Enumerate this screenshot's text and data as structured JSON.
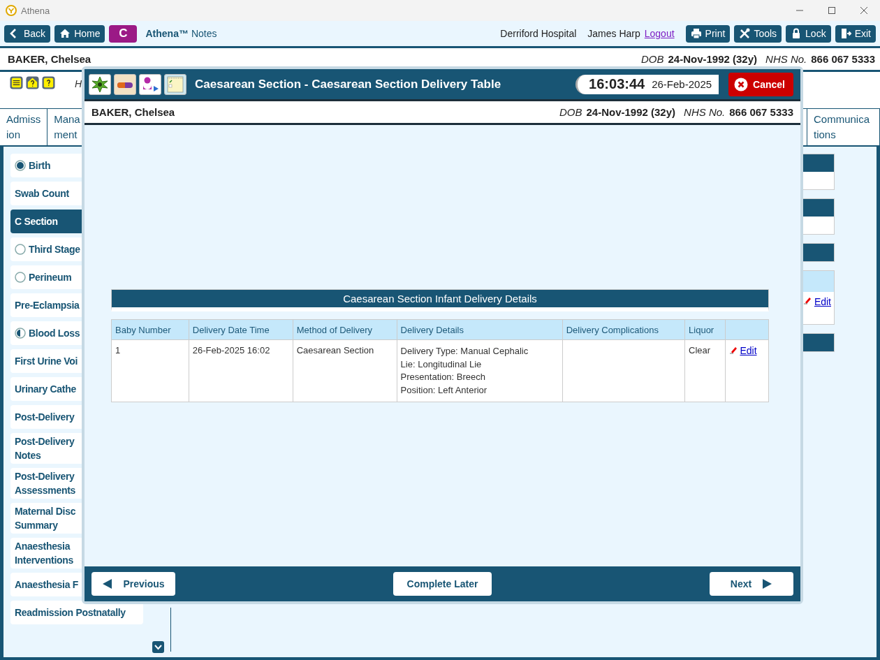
{
  "window": {
    "title": "Athena"
  },
  "toolbar": {
    "nav_buttons": [
      {
        "label": "Back"
      },
      {
        "label": "Home"
      }
    ],
    "app_badge": "C",
    "app_name": "Athena™",
    "app_suffix": "Notes",
    "hospital": "Derriford Hospital",
    "user": "James Harp",
    "logout": "Logout",
    "actions": [
      {
        "label": "Print"
      },
      {
        "label": "Tools"
      },
      {
        "label": "Lock"
      },
      {
        "label": "Exit"
      }
    ]
  },
  "patient": {
    "name": "BAKER, Chelsea",
    "dob_label": "DOB",
    "dob": "24-Nov-1992 (32y)",
    "nhs_label": "NHS No.",
    "nhs": "866 067 5333"
  },
  "header_fragment": "H",
  "tabs": [
    {
      "lines": [
        "Admiss",
        "ion"
      ]
    },
    {
      "lines": [
        "Mana",
        "ment"
      ]
    },
    {
      "lines": [
        "Communica",
        "tions"
      ]
    }
  ],
  "sidebar": {
    "items": [
      {
        "label": "Birth",
        "kind": "complete",
        "selected": false
      },
      {
        "label": "Swab Count",
        "kind": "plain",
        "selected": false
      },
      {
        "label": "C Section",
        "kind": "plain",
        "selected": true
      },
      {
        "label": "Third Stage",
        "kind": "empty",
        "selected": false
      },
      {
        "label": "Perineum",
        "kind": "empty",
        "selected": false
      },
      {
        "label": "Pre-Eclampsia",
        "kind": "plain",
        "selected": false
      },
      {
        "label": "Blood Loss",
        "kind": "partial",
        "selected": false
      },
      {
        "label": "First Urine Voi",
        "kind": "plain",
        "selected": false
      },
      {
        "label": "Urinary Cathe",
        "kind": "plain",
        "selected": false
      },
      {
        "label": "Post-Delivery",
        "kind": "plain",
        "selected": false
      },
      {
        "label": "Post-Delivery\nNotes",
        "kind": "plain",
        "selected": false
      },
      {
        "label": "Post-Delivery\nAssessments",
        "kind": "plain",
        "selected": false
      },
      {
        "label": "Maternal Disc\nSummary",
        "kind": "plain",
        "selected": false
      },
      {
        "label": "Anaesthesia\nInterventions",
        "kind": "plain",
        "selected": false
      },
      {
        "label": "Anaesthesia F",
        "kind": "plain",
        "selected": false
      },
      {
        "label": "Readmission Postnatally",
        "kind": "plain",
        "selected": false
      }
    ]
  },
  "right_panel": {
    "edit_link": "Edit"
  },
  "dialog": {
    "title": "Caesarean Section - Caesarean Section Delivery Table",
    "time": "16:03:44",
    "date": "26-Feb-2025",
    "cancel": "Cancel",
    "patient": {
      "name": "BAKER, Chelsea",
      "dob_label": "DOB",
      "dob": "24-Nov-1992 (32y)",
      "nhs_label": "NHS No.",
      "nhs": "866 067 5333"
    },
    "section_title": "Caesarean Section Infant Delivery Details",
    "table": {
      "columns": [
        "Baby Number",
        "Delivery Date Time",
        "Method of Delivery",
        "Delivery Details",
        "Delivery Complications",
        "Liquor"
      ],
      "rows": [
        {
          "baby_number": "1",
          "delivery_date_time": "26-Feb-2025 16:02",
          "method": "Caesarean Section",
          "details": [
            "Delivery Type: Manual Cephalic",
            "Lie: Longitudinal Lie",
            "Presentation: Breech",
            "Position: Left Anterior"
          ],
          "liquor": "Clear",
          "edit": "Edit"
        }
      ]
    },
    "footer": {
      "previous": "Previous",
      "complete_later": "Complete Later",
      "next": "Next"
    }
  }
}
